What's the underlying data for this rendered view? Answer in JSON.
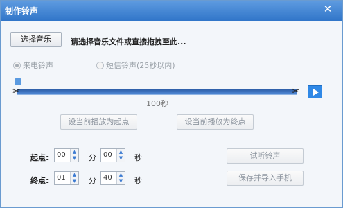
{
  "window": {
    "title": "制作铃声",
    "close_glyph": "✕"
  },
  "toolbar": {
    "select_music_label": "选择音乐",
    "hint_text": "请选择音乐文件或直接拖拽至此..."
  },
  "ringtype": {
    "incoming_label": "来电铃声",
    "sms_label": "短信铃声(25秒以内)",
    "selected": "incoming"
  },
  "timeline": {
    "duration": "100秒",
    "scissors_glyph": "✂"
  },
  "actions": {
    "set_start_label": "设当前播放为起点",
    "set_end_label": "设当前播放为终点",
    "preview_label": "试听铃声",
    "save_import_label": "保存并导入手机"
  },
  "start": {
    "label": "起点:",
    "minutes": "00",
    "minute_unit": "分",
    "seconds": "00",
    "second_unit": "秒"
  },
  "end": {
    "label": "终点:",
    "minutes": "01",
    "minute_unit": "分",
    "seconds": "40",
    "second_unit": "秒"
  },
  "spinner": {
    "up_glyph": "▲",
    "down_glyph": "▼"
  }
}
